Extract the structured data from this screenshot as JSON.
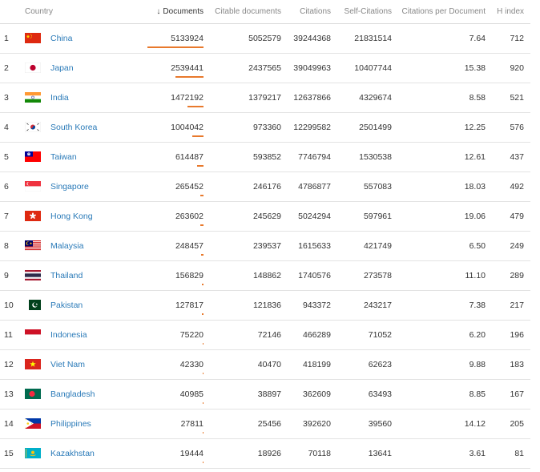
{
  "header": {
    "country": "Country",
    "documents": "Documents",
    "documents_sort_icon": "↓",
    "citable_documents": "Citable documents",
    "citations": "Citations",
    "self_citations": "Self-Citations",
    "citations_per_document": "Citations per Document",
    "h_index": "H index"
  },
  "rows": [
    {
      "rank": "1",
      "country": "China",
      "flag": "china-flag-icon",
      "documents": "5133924",
      "documents_value": 5133924,
      "citable": "5052579",
      "citations": "39244368",
      "self": "21831514",
      "cpd": "7.64",
      "h": "712"
    },
    {
      "rank": "2",
      "country": "Japan",
      "flag": "japan-flag-icon",
      "documents": "2539441",
      "documents_value": 2539441,
      "citable": "2437565",
      "citations": "39049963",
      "self": "10407744",
      "cpd": "15.38",
      "h": "920"
    },
    {
      "rank": "3",
      "country": "India",
      "flag": "india-flag-icon",
      "documents": "1472192",
      "documents_value": 1472192,
      "citable": "1379217",
      "citations": "12637866",
      "self": "4329674",
      "cpd": "8.58",
      "h": "521"
    },
    {
      "rank": "4",
      "country": "South Korea",
      "flag": "south-korea-flag-icon",
      "documents": "1004042",
      "documents_value": 1004042,
      "citable": "973360",
      "citations": "12299582",
      "self": "2501499",
      "cpd": "12.25",
      "h": "576"
    },
    {
      "rank": "5",
      "country": "Taiwan",
      "flag": "taiwan-flag-icon",
      "documents": "614487",
      "documents_value": 614487,
      "citable": "593852",
      "citations": "7746794",
      "self": "1530538",
      "cpd": "12.61",
      "h": "437"
    },
    {
      "rank": "6",
      "country": "Singapore",
      "flag": "singapore-flag-icon",
      "documents": "265452",
      "documents_value": 265452,
      "citable": "246176",
      "citations": "4786877",
      "self": "557083",
      "cpd": "18.03",
      "h": "492"
    },
    {
      "rank": "7",
      "country": "Hong Kong",
      "flag": "hong-kong-flag-icon",
      "documents": "263602",
      "documents_value": 263602,
      "citable": "245629",
      "citations": "5024294",
      "self": "597961",
      "cpd": "19.06",
      "h": "479"
    },
    {
      "rank": "8",
      "country": "Malaysia",
      "flag": "malaysia-flag-icon",
      "documents": "248457",
      "documents_value": 248457,
      "citable": "239537",
      "citations": "1615633",
      "self": "421749",
      "cpd": "6.50",
      "h": "249"
    },
    {
      "rank": "9",
      "country": "Thailand",
      "flag": "thailand-flag-icon",
      "documents": "156829",
      "documents_value": 156829,
      "citable": "148862",
      "citations": "1740576",
      "self": "273578",
      "cpd": "11.10",
      "h": "289"
    },
    {
      "rank": "10",
      "country": "Pakistan",
      "flag": "pakistan-flag-icon",
      "documents": "127817",
      "documents_value": 127817,
      "citable": "121836",
      "citations": "943372",
      "self": "243217",
      "cpd": "7.38",
      "h": "217"
    },
    {
      "rank": "11",
      "country": "Indonesia",
      "flag": "indonesia-flag-icon",
      "documents": "75220",
      "documents_value": 75220,
      "citable": "72146",
      "citations": "466289",
      "self": "71052",
      "cpd": "6.20",
      "h": "196"
    },
    {
      "rank": "12",
      "country": "Viet Nam",
      "flag": "viet-nam-flag-icon",
      "documents": "42330",
      "documents_value": 42330,
      "citable": "40470",
      "citations": "418199",
      "self": "62623",
      "cpd": "9.88",
      "h": "183"
    },
    {
      "rank": "13",
      "country": "Bangladesh",
      "flag": "bangladesh-flag-icon",
      "documents": "40985",
      "documents_value": 40985,
      "citable": "38897",
      "citations": "362609",
      "self": "63493",
      "cpd": "8.85",
      "h": "167"
    },
    {
      "rank": "14",
      "country": "Philippines",
      "flag": "philippines-flag-icon",
      "documents": "27811",
      "documents_value": 27811,
      "citable": "25456",
      "citations": "392620",
      "self": "39560",
      "cpd": "14.12",
      "h": "205"
    },
    {
      "rank": "15",
      "country": "Kazakhstan",
      "flag": "kazakhstan-flag-icon",
      "documents": "19444",
      "documents_value": 19444,
      "citable": "18926",
      "citations": "70118",
      "self": "13641",
      "cpd": "3.61",
      "h": "81"
    }
  ],
  "colors": {
    "link": "#2a7ab8",
    "bar": "#e8792c",
    "header_text": "#888888"
  }
}
